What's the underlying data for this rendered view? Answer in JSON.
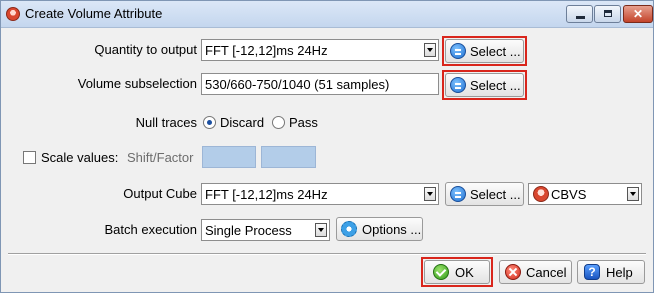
{
  "window": {
    "title": "Create Volume Attribute",
    "controls": [
      "minimize-icon",
      "maximize-icon",
      "close-icon"
    ]
  },
  "quantity": {
    "label": "Quantity to output",
    "value": "FFT [-12,12]ms 24Hz",
    "select_label": "Select ..."
  },
  "volume": {
    "label": "Volume subselection",
    "value": "530/660-750/1040 (51 samples)",
    "select_label": "Select ..."
  },
  "null_traces": {
    "label": "Null traces",
    "options": [
      "Discard",
      "Pass"
    ],
    "selected": "Discard"
  },
  "scale": {
    "label": "Scale values:",
    "checked": false,
    "shift_factor_label": "Shift/Factor",
    "shift": "",
    "factor": ""
  },
  "output_cube": {
    "label": "Output Cube",
    "value": "FFT [-12,12]ms 24Hz",
    "select_label": "Select ...",
    "survey": "CBVS"
  },
  "batch": {
    "label": "Batch execution",
    "value": "Single Process",
    "options_label": "Options ..."
  },
  "buttons": {
    "ok": "OK",
    "cancel": "Cancel",
    "help": "Help"
  },
  "highlight_color": "#d9261c"
}
